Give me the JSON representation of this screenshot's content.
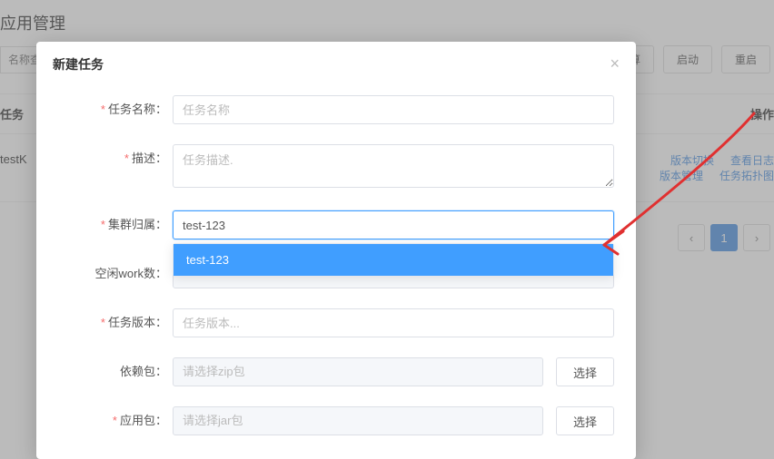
{
  "bg": {
    "page_title": "应用管理",
    "search_placeholder": "名称查",
    "top_buttons": {
      "realtime": "实时计算",
      "start": "启动",
      "restart": "重启"
    },
    "table": {
      "col_task": "任务",
      "col_ops": "操作"
    },
    "row1": {
      "name": "testK"
    },
    "links": {
      "version_switch": "版本切换",
      "view_log": "查看日志",
      "version_manage": "版本管理",
      "task_topo": "任务拓扑图"
    },
    "pagination": {
      "prev": "‹",
      "page1": "1",
      "next": "›"
    }
  },
  "modal": {
    "title": "新建任务",
    "close": "×",
    "task_name": {
      "label": "任务名称：",
      "placeholder": "任务名称"
    },
    "desc": {
      "label": "描述：",
      "placeholder": "任务描述."
    },
    "cluster": {
      "label": "集群归属：",
      "value": "test-123",
      "option1": "test-123"
    },
    "idle_work": {
      "label": "空闲work数：",
      "value": ""
    },
    "task_version": {
      "label": "任务版本：",
      "placeholder": "任务版本..."
    },
    "dep_pkg": {
      "label": "依赖包：",
      "placeholder": "请选择zip包",
      "btn": "选择"
    },
    "app_pkg": {
      "label": "应用包：",
      "placeholder": "请选择jar包",
      "btn": "选择"
    }
  }
}
